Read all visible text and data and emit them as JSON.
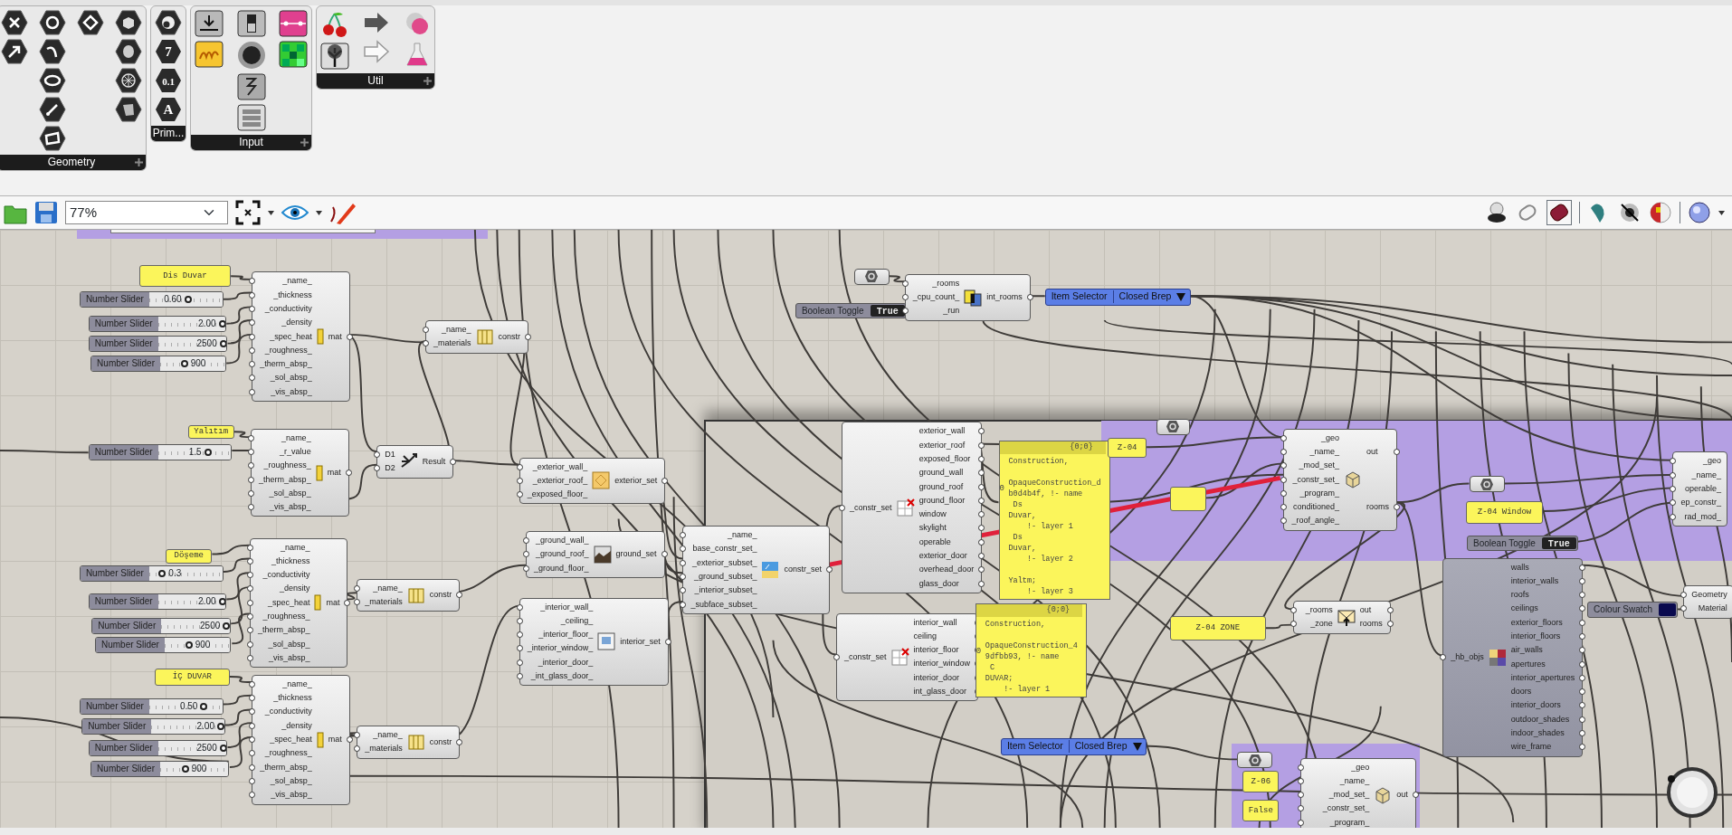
{
  "ribbon": {
    "panels": [
      {
        "title": "Geometry"
      },
      {
        "title": "Prim...",
        "glyphs": [
          "7",
          "0.1",
          "A"
        ]
      },
      {
        "title": "Input"
      },
      {
        "title": "Util"
      }
    ]
  },
  "toolbar": {
    "zoom": "77%"
  },
  "canvas": {
    "nodes": [
      {
        "kind": "panel",
        "text": "Dis Duvar"
      },
      {
        "kind": "slider",
        "label": "Number Slider",
        "value": "0.60",
        "level": 0.53
      },
      {
        "kind": "slider",
        "label": "Number Slider",
        "value": "2.00",
        "level": 0.95
      },
      {
        "kind": "slider",
        "label": "Number Slider",
        "value": "2500",
        "level": 0.95
      },
      {
        "kind": "slider",
        "label": "Number Slider",
        "value": "900",
        "level": 0.37
      },
      {
        "kind": "component",
        "inputs": [
          "_name_",
          "_thickness",
          "_conductivity",
          "_density",
          "_spec_heat",
          "_roughness_",
          "_therm_absp_",
          "_sol_absp_",
          "_vis_absp_"
        ],
        "outputs": [
          "mat"
        ]
      },
      {
        "kind": "component",
        "inputs": [
          "_name_",
          "_materials"
        ],
        "outputs": [
          "constr"
        ]
      },
      {
        "kind": "panel",
        "text": "Yalıtım"
      },
      {
        "kind": "slider",
        "label": "Number Slider",
        "value": "1.5",
        "level": 0.68
      },
      {
        "kind": "component",
        "inputs": [
          "_name_",
          "_r_value",
          "_roughness_",
          "_therm_absp_",
          "_sol_absp_",
          "_vis_absp_"
        ],
        "outputs": [
          "mat"
        ]
      },
      {
        "kind": "component",
        "inputs": [
          "D1",
          "D2"
        ],
        "outputs": [
          "Result"
        ]
      },
      {
        "kind": "component",
        "inputs": [
          "_exterior_wall_",
          "_exterior_roof_",
          "_exposed_floor_"
        ],
        "outputs": [
          "exterior_set"
        ]
      },
      {
        "kind": "panel",
        "text": "Döşeme"
      },
      {
        "kind": "slider",
        "label": "Number Slider",
        "value": "0.3",
        "level": 0.18
      },
      {
        "kind": "slider",
        "label": "Number Slider",
        "value": "2.00",
        "level": 0.95
      },
      {
        "kind": "slider",
        "label": "Number Slider",
        "value": "2500",
        "level": 0.95
      },
      {
        "kind": "slider",
        "label": "Number Slider",
        "value": "900",
        "level": 0.37
      },
      {
        "kind": "component",
        "inputs": [
          "_name_",
          "_thickness",
          "_conductivity",
          "_density",
          "_spec_heat",
          "_roughness_",
          "_therm_absp_",
          "_sol_absp_",
          "_vis_absp_"
        ],
        "outputs": [
          "mat"
        ]
      },
      {
        "kind": "component",
        "inputs": [
          "_name_",
          "_materials"
        ],
        "outputs": [
          "constr"
        ]
      },
      {
        "kind": "component",
        "inputs": [
          "_ground_wall_",
          "_ground_roof_",
          "_ground_floor_"
        ],
        "outputs": [
          "ground_set"
        ]
      },
      {
        "kind": "panel",
        "text": "İÇ DUVAR"
      },
      {
        "kind": "slider",
        "label": "Number Slider",
        "value": "0.50",
        "level": 0.75
      },
      {
        "kind": "slider",
        "label": "Number Slider",
        "value": "2.00",
        "level": 0.95
      },
      {
        "kind": "slider",
        "label": "Number Slider",
        "value": "2500",
        "level": 0.95
      },
      {
        "kind": "slider",
        "label": "Number Slider",
        "value": "900",
        "level": 0.37
      },
      {
        "kind": "component",
        "inputs": [
          "_name_",
          "_thickness",
          "_conductivity",
          "_density",
          "_spec_heat",
          "_roughness_",
          "_therm_absp_",
          "_sol_absp_",
          "_vis_absp_"
        ],
        "outputs": [
          "mat"
        ]
      },
      {
        "kind": "component",
        "inputs": [
          "_name_",
          "_materials"
        ],
        "outputs": [
          "constr"
        ]
      },
      {
        "kind": "component",
        "inputs": [
          "_interior_wall_",
          "_ceiling_",
          "_interior_floor_",
          "_interior_window_",
          "_interior_door_",
          "_int_glass_door_"
        ],
        "outputs": [
          "interior_set"
        ]
      },
      {
        "kind": "component",
        "inputs": [
          "_name_",
          "base_constr_set_",
          "_exterior_subset_",
          "_ground_subset_",
          "_interior_subset_",
          "_subface_subset_"
        ],
        "outputs": [
          "constr_set"
        ]
      },
      {
        "kind": "component",
        "inputs": [
          "_constr_set"
        ],
        "outputs": [
          "exterior_wall",
          "exterior_roof",
          "exposed_floor",
          "ground_wall",
          "ground_roof",
          "ground_floor",
          "window",
          "skylight",
          "operable",
          "exterior_door",
          "overhead_door",
          "glass_door"
        ]
      },
      {
        "kind": "component",
        "inputs": [
          "_constr_set"
        ],
        "outputs": [
          "interior_wall",
          "ceiling",
          "interior_floor",
          "interior_window",
          "interior_door",
          "int_glass_door"
        ]
      },
      {
        "kind": "textpanel",
        "header": "{0;0}",
        "index": "0",
        "text": "Construction,\n\nOpaqueConstruction_d\nb0d4b4f, !- name\n Ds\nDuvar,\n    !- layer 1\n Ds\nDuvar,\n    !- layer 2\n\nYaltm;\n    !- layer 3"
      },
      {
        "kind": "textpanel",
        "header": "{0;0}",
        "index": "0",
        "text": "Construction,\n\nOpaqueConstruction_4\n9dfbb93, !- name\n C\nDUVAR;\n    !- layer 1"
      },
      {
        "kind": "param"
      },
      {
        "kind": "toggle",
        "label": "Boolean Toggle",
        "value": "True"
      },
      {
        "kind": "component",
        "inputs": [
          "_rooms",
          "_cpu_count_",
          "_run"
        ],
        "outputs": [
          "int_rooms"
        ]
      },
      {
        "kind": "selector",
        "label": "Item Selector",
        "value": "Closed Brep"
      },
      {
        "kind": "selector",
        "label": "Item Selector",
        "value": "Closed Brep"
      },
      {
        "kind": "param"
      },
      {
        "kind": "panel",
        "text": "Z-04"
      },
      {
        "kind": "panel"
      },
      {
        "kind": "component",
        "inputs": [
          "_geo",
          "_name_",
          "_mod_set_",
          "_constr_set_",
          "_program_",
          "conditioned_",
          "_roof_angle_"
        ],
        "outputs": [
          "out",
          "rooms"
        ]
      },
      {
        "kind": "param"
      },
      {
        "kind": "panel",
        "text": "Z-04 Window"
      },
      {
        "kind": "toggle",
        "label": "Boolean Toggle",
        "value": "True"
      },
      {
        "kind": "component",
        "inputs": [
          "_geo",
          "_name_",
          "operable_",
          "ep_constr_",
          "rad_mod_"
        ]
      },
      {
        "kind": "component",
        "inputs": [
          "_hb_objs"
        ],
        "outputs": [
          "walls",
          "interior_walls",
          "roofs",
          "ceilings",
          "exterior_floors",
          "interior_floors",
          "air_walls",
          "apertures",
          "interior_apertures",
          "doors",
          "interior_doors",
          "outdoor_shades",
          "indoor_shades",
          "wire_frame"
        ]
      },
      {
        "kind": "swatch",
        "label": "Colour Swatch",
        "color": "#0a0a4e"
      },
      {
        "kind": "component",
        "inputs": [
          "Geometry",
          "Material"
        ]
      },
      {
        "kind": "panel",
        "text": "Z-04 ZONE"
      },
      {
        "kind": "component",
        "inputs": [
          "_rooms",
          "_zone"
        ],
        "outputs": [
          "out",
          "rooms"
        ]
      },
      {
        "kind": "param"
      },
      {
        "kind": "panel",
        "text": "Z-06"
      },
      {
        "kind": "panel",
        "text": "False"
      },
      {
        "kind": "component",
        "inputs": [
          "_geo",
          "_name_",
          "_mod_set_",
          "_constr_set_",
          "_program_"
        ],
        "outputs": [
          "out"
        ]
      }
    ]
  }
}
